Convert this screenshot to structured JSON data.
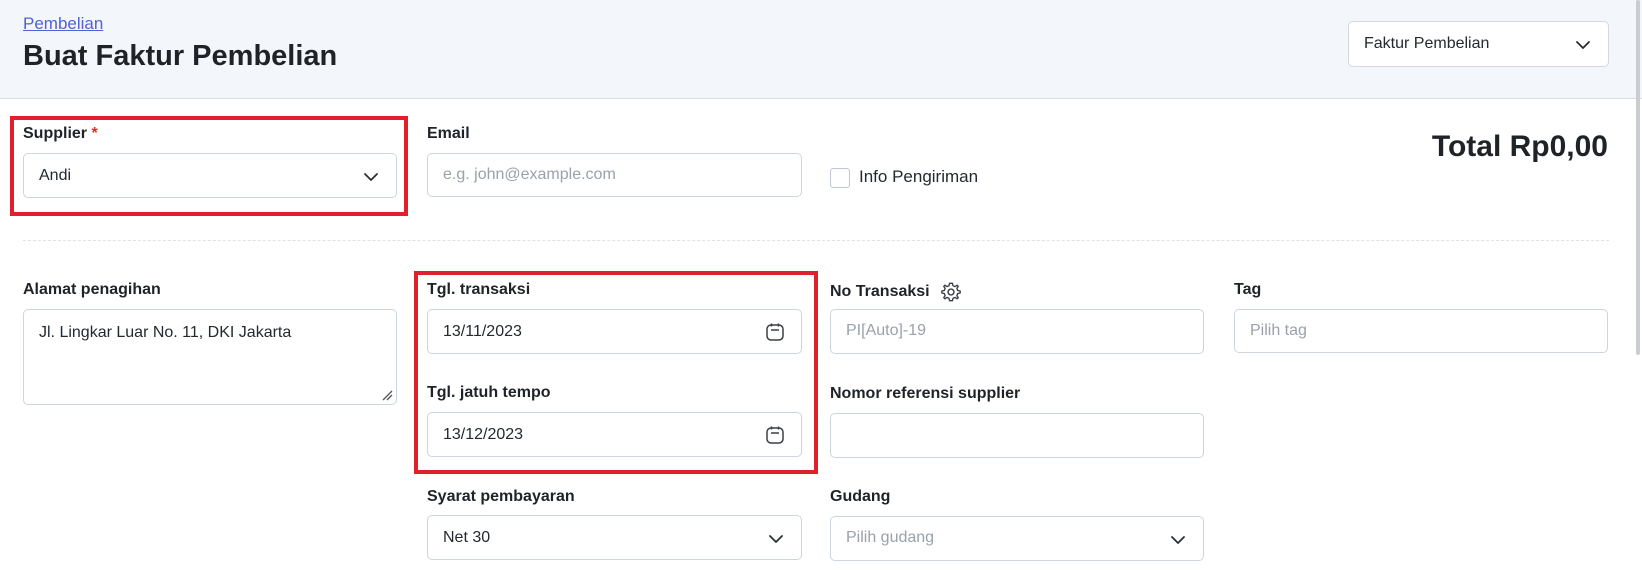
{
  "header": {
    "breadcrumb": "Pembelian",
    "title": "Buat Faktur Pembelian",
    "doc_type_selected": "Faktur Pembelian"
  },
  "form": {
    "supplier": {
      "label": "Supplier",
      "required_mark": "*",
      "value": "Andi"
    },
    "email": {
      "label": "Email",
      "placeholder": "e.g. john@example.com"
    },
    "shipping_info": {
      "label": "Info Pengiriman",
      "checked": false
    },
    "total": "Total Rp0,00",
    "billing_address": {
      "label": "Alamat penagihan",
      "value": "Jl. Lingkar Luar No. 11, DKI Jakarta"
    },
    "transaction_date": {
      "label": "Tgl. transaksi",
      "value": "13/11/2023"
    },
    "due_date": {
      "label": "Tgl. jatuh tempo",
      "value": "13/12/2023"
    },
    "payment_terms": {
      "label": "Syarat pembayaran",
      "value": "Net 30"
    },
    "transaction_no": {
      "label": "No Transaksi",
      "placeholder": "PI[Auto]-19"
    },
    "supplier_ref": {
      "label": "Nomor referensi supplier",
      "value": ""
    },
    "warehouse": {
      "label": "Gudang",
      "placeholder": "Pilih gudang"
    },
    "tag": {
      "label": "Tag",
      "placeholder": "Pilih tag"
    }
  },
  "colors": {
    "highlight": "#e0202a",
    "link": "#4f62d6",
    "header_bg": "#f3f6fa"
  },
  "icons": [
    "chevron-down-icon",
    "calendar-icon",
    "gear-icon",
    "resize-grip-icon"
  ]
}
